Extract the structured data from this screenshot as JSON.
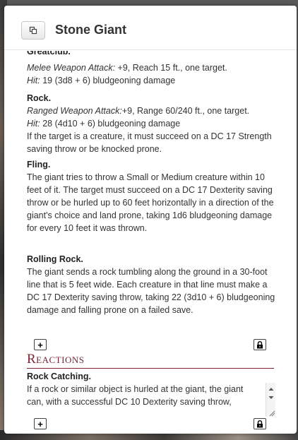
{
  "title": "Stone Giant",
  "actions": [
    {
      "name": "Greatclub.",
      "attack_type": "Melee Weapon Attack:",
      "attack_rest": "  +9, Reach 15 ft.,  one target.",
      "hit_label": "Hit:",
      "hit_rest": " 19 (3d8 + 6) bludgeoning damage"
    },
    {
      "name": "Rock.",
      "attack_type": "Ranged Weapon Attack:",
      "attack_rest": "+9, Range 60/240 ft.,  one target.",
      "hit_label": "Hit:",
      "hit_rest": " 28 (4d10 + 6) bludgeoning damage",
      "extra": "If the target is a creature, it must succeed on a DC 17 Strength saving throw or be knocked prone."
    },
    {
      "name": "Fling.",
      "text": "The giant tries to throw a Small or Medium creature within 10 feet of it. The target must succeed on a DC 17 Dexterity saving throw or be hurled up to 60 feet horizontally in a direction of the giant's choice and land prone, taking 1d6 bludgeoning damage for every 10 feet it was thrown."
    },
    {
      "name": "Rolling Rock.",
      "text": "The giant sends a rock tumbling along the ground in a 30-foot line that is 5 feet wide. Each creature in that line must make a DC 17 Dexterity saving throw, taking 22 (3d10 + 6) bludgeoning damage and falling prone on a failed save."
    }
  ],
  "add_label": "+",
  "reactions": {
    "title": "Reactions",
    "name": "Rock Catching.",
    "text": "If a rock or similar object is hurled at the giant, the giant can, with a successful DC 10 Dexterity saving throw,"
  }
}
